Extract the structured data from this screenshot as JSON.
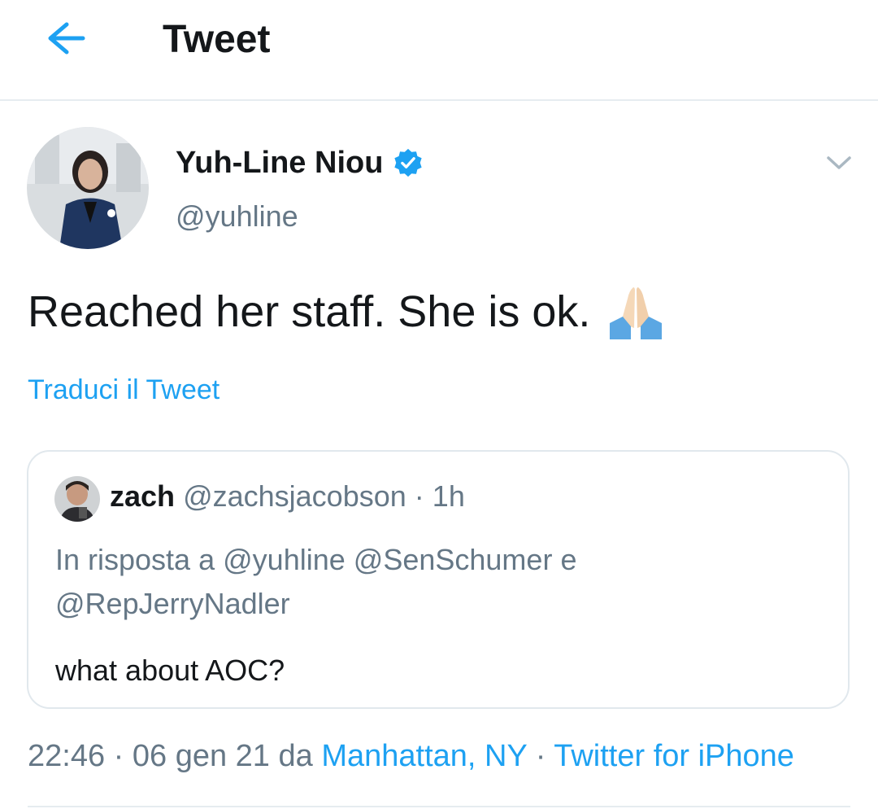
{
  "header": {
    "title": "Tweet",
    "back_icon": "arrow-left-icon"
  },
  "tweet": {
    "author_name": "Yuh-Line Niou",
    "author_handle": "@yuhline",
    "text": "Reached her staff. She is ok.",
    "emoji": "folded-hands-icon",
    "translate_label": "Traduci il Tweet",
    "time": "22:46",
    "sep1": "·",
    "date": "06 gen 21",
    "da": "da",
    "location": "Manhattan, NY",
    "sep2": "·",
    "source": "Twitter for iPhone"
  },
  "quoted": {
    "name": "zach",
    "handle": "@zachsjacobson",
    "dot": "·",
    "age": "1h",
    "reply_prefix": "In risposta a",
    "reply_to": [
      "@yuhline",
      "@SenSchumer",
      "@RepJerryNadler"
    ],
    "reply_joiner": "e",
    "text": "what about AOC?"
  },
  "colors": {
    "accent": "#1da1f2",
    "secondary_text": "#657786",
    "border": "#e1e8ed"
  }
}
